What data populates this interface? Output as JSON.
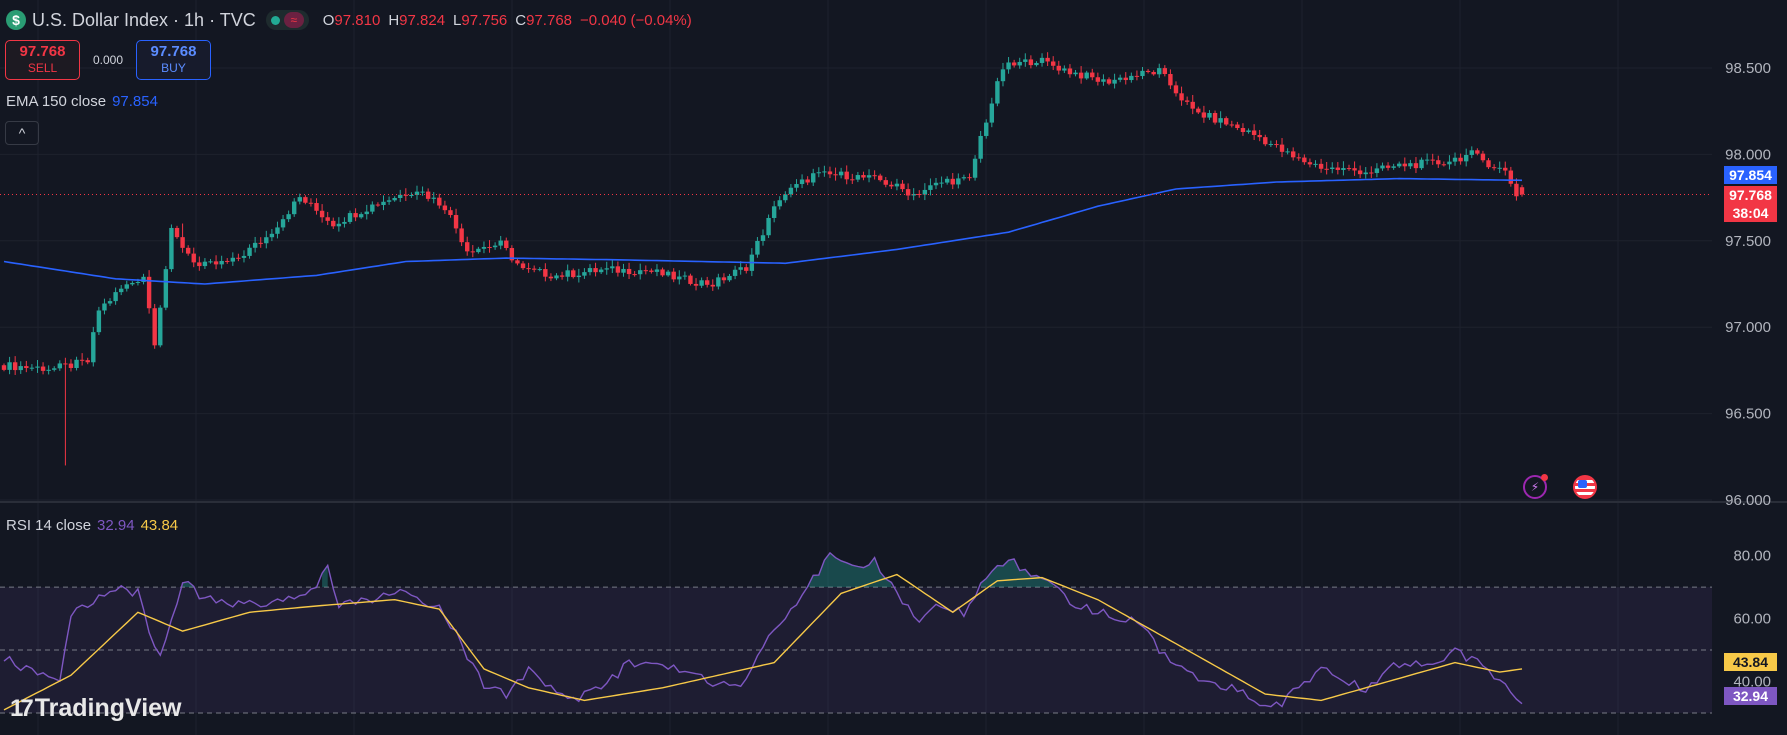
{
  "header": {
    "symbol_title": "U.S. Dollar Index · 1h · TVC",
    "ohlc": [
      {
        "key": "O",
        "value": "97.810"
      },
      {
        "key": "H",
        "value": "97.824"
      },
      {
        "key": "L",
        "value": "97.756"
      },
      {
        "key": "C",
        "value": "97.768"
      }
    ],
    "change": "−0.040 (−0.04%)"
  },
  "trade": {
    "sell_price": "97.768",
    "sell_label": "SELL",
    "spread": "0.000",
    "buy_price": "97.768",
    "buy_label": "BUY"
  },
  "collapse_glyph": "^",
  "branding": {
    "logo_mark": "17",
    "name": "TradingView"
  },
  "colors": {
    "background": "#131722",
    "up": "#26a69a",
    "down": "#f23645",
    "ema": "#2962ff",
    "rsi": "#7e57c2",
    "rsi_ma": "#f7c948"
  },
  "icons": [
    "dollar-icon",
    "market-open-icon",
    "lightning-icon",
    "us-flag-icon",
    "collapse-icon"
  ],
  "chart_data": [
    {
      "type": "line",
      "name": "price",
      "indicator_label": "EMA 150 close",
      "indicator_value": "97.854",
      "y_ticks": [
        "98.500",
        "98.000",
        "97.500",
        "97.000",
        "96.500",
        "96.000"
      ],
      "ylim": [
        96.0,
        98.5
      ],
      "last_price": "97.768",
      "countdown": "38:04",
      "ema_value": "97.854",
      "price_keyframes": [
        [
          0,
          96.78
        ],
        [
          10,
          96.76
        ],
        [
          16,
          96.8
        ],
        [
          18,
          97.1
        ],
        [
          22,
          97.22
        ],
        [
          26,
          97.3
        ],
        [
          28,
          96.92
        ],
        [
          31,
          97.55
        ],
        [
          36,
          97.35
        ],
        [
          42,
          97.38
        ],
        [
          48,
          97.52
        ],
        [
          54,
          97.75
        ],
        [
          60,
          97.6
        ],
        [
          68,
          97.72
        ],
        [
          75,
          97.8
        ],
        [
          80,
          97.7
        ],
        [
          84,
          97.45
        ],
        [
          90,
          97.48
        ],
        [
          94,
          97.33
        ],
        [
          100,
          97.3
        ],
        [
          108,
          97.33
        ],
        [
          116,
          97.33
        ],
        [
          122,
          97.28
        ],
        [
          128,
          97.25
        ],
        [
          134,
          97.35
        ],
        [
          140,
          97.75
        ],
        [
          146,
          97.88
        ],
        [
          152,
          97.88
        ],
        [
          158,
          97.85
        ],
        [
          164,
          97.77
        ],
        [
          170,
          97.85
        ],
        [
          174,
          97.85
        ],
        [
          176,
          98.1
        ],
        [
          180,
          98.5
        ],
        [
          186,
          98.55
        ],
        [
          192,
          98.48
        ],
        [
          198,
          98.42
        ],
        [
          204,
          98.46
        ],
        [
          208,
          98.48
        ],
        [
          214,
          98.25
        ],
        [
          220,
          98.18
        ],
        [
          226,
          98.1
        ],
        [
          232,
          97.98
        ],
        [
          238,
          97.92
        ],
        [
          246,
          97.9
        ],
        [
          252,
          97.94
        ],
        [
          258,
          97.95
        ],
        [
          264,
          98.0
        ],
        [
          270,
          97.9
        ],
        [
          272,
          97.77
        ]
      ],
      "ema_keyframes": [
        [
          0,
          97.38
        ],
        [
          20,
          97.28
        ],
        [
          36,
          97.25
        ],
        [
          56,
          97.3
        ],
        [
          72,
          97.38
        ],
        [
          90,
          97.4
        ],
        [
          110,
          97.39
        ],
        [
          140,
          97.37
        ],
        [
          160,
          97.45
        ],
        [
          180,
          97.55
        ],
        [
          196,
          97.7
        ],
        [
          210,
          97.8
        ],
        [
          228,
          97.84
        ],
        [
          250,
          97.86
        ],
        [
          272,
          97.85
        ]
      ]
    },
    {
      "type": "line",
      "name": "rsi",
      "indicator_label": "RSI 14 close",
      "rsi_value": "32.94",
      "ma_value": "43.84",
      "y_ticks": [
        "80.00",
        "60.00",
        "40.00"
      ],
      "ylim": [
        30,
        84
      ],
      "bands": [
        70,
        50,
        30
      ],
      "rsi_keyframes": [
        [
          0,
          48
        ],
        [
          4,
          44
        ],
        [
          8,
          42
        ],
        [
          10,
          40
        ],
        [
          12,
          62
        ],
        [
          16,
          66
        ],
        [
          20,
          70
        ],
        [
          24,
          68
        ],
        [
          26,
          56
        ],
        [
          28,
          48
        ],
        [
          32,
          72
        ],
        [
          36,
          66
        ],
        [
          40,
          65
        ],
        [
          46,
          64
        ],
        [
          50,
          65
        ],
        [
          56,
          70
        ],
        [
          58,
          77
        ],
        [
          60,
          64
        ],
        [
          64,
          66
        ],
        [
          68,
          67
        ],
        [
          72,
          70
        ],
        [
          74,
          66
        ],
        [
          78,
          64
        ],
        [
          82,
          52
        ],
        [
          86,
          38
        ],
        [
          90,
          36
        ],
        [
          94,
          44
        ],
        [
          98,
          38
        ],
        [
          102,
          34
        ],
        [
          108,
          39
        ],
        [
          112,
          46
        ],
        [
          118,
          45
        ],
        [
          122,
          44
        ],
        [
          126,
          40
        ],
        [
          132,
          39
        ],
        [
          136,
          52
        ],
        [
          140,
          60
        ],
        [
          144,
          70
        ],
        [
          148,
          80
        ],
        [
          152,
          76
        ],
        [
          156,
          78
        ],
        [
          160,
          68
        ],
        [
          164,
          60
        ],
        [
          168,
          64
        ],
        [
          172,
          62
        ],
        [
          176,
          74
        ],
        [
          180,
          79
        ],
        [
          184,
          74
        ],
        [
          188,
          70
        ],
        [
          192,
          64
        ],
        [
          196,
          62
        ],
        [
          200,
          60
        ],
        [
          204,
          58
        ],
        [
          208,
          48
        ],
        [
          212,
          42
        ],
        [
          216,
          40
        ],
        [
          220,
          38
        ],
        [
          224,
          34
        ],
        [
          228,
          32
        ],
        [
          232,
          38
        ],
        [
          236,
          44
        ],
        [
          240,
          40
        ],
        [
          244,
          38
        ],
        [
          248,
          44
        ],
        [
          252,
          46
        ],
        [
          256,
          44
        ],
        [
          260,
          50
        ],
        [
          264,
          46
        ],
        [
          268,
          40
        ],
        [
          272,
          33
        ]
      ],
      "ma_keyframes": [
        [
          0,
          31
        ],
        [
          12,
          42
        ],
        [
          24,
          62
        ],
        [
          32,
          56
        ],
        [
          44,
          62
        ],
        [
          56,
          64
        ],
        [
          70,
          66
        ],
        [
          78,
          63
        ],
        [
          86,
          44
        ],
        [
          94,
          38
        ],
        [
          104,
          34
        ],
        [
          118,
          38
        ],
        [
          128,
          42
        ],
        [
          138,
          46
        ],
        [
          150,
          68
        ],
        [
          160,
          74
        ],
        [
          170,
          62
        ],
        [
          178,
          72
        ],
        [
          186,
          73
        ],
        [
          196,
          66
        ],
        [
          206,
          56
        ],
        [
          216,
          46
        ],
        [
          226,
          36
        ],
        [
          236,
          34
        ],
        [
          248,
          40
        ],
        [
          260,
          46
        ],
        [
          268,
          43
        ],
        [
          272,
          44
        ]
      ]
    }
  ]
}
